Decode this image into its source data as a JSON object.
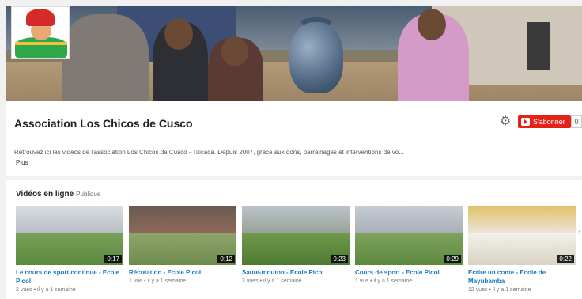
{
  "channel": {
    "title": "Association Los Chicos de Cusco",
    "description": "Retrouvez ici les vidéos de l'association Los Chicos de Cusco - Titicaca. Depuis 2007, grâce aux dons, parrainages et interventions de vo...",
    "more_label": "Plus",
    "subscribe_label": "S'abonner",
    "subscriber_count": "0"
  },
  "section": {
    "title": "Vidéos en ligne",
    "visibility": "Publique"
  },
  "videos": [
    {
      "title": "Le cours de sport continue - Ecole Picol",
      "duration": "0:17",
      "views": "2 vues",
      "age": "il y a 1 semaine"
    },
    {
      "title": "Récréation - Ecole Picol",
      "duration": "0:12",
      "views": "1 vue",
      "age": "il y a 1 semaine"
    },
    {
      "title": "Saute-mouton - Ecole Picol",
      "duration": "0:23",
      "views": "3 vues",
      "age": "il y a 1 semaine"
    },
    {
      "title": "Cours de sport - Ecole Picol",
      "duration": "0:29",
      "views": "1 vue",
      "age": "il y a 1 semaine"
    },
    {
      "title": "Ecrire un conte - Ecole de Mayubamba",
      "duration": "0:22",
      "views": "12 vues",
      "age": "il y a 1 semaine"
    }
  ],
  "colors": {
    "subscribe": "#e62117",
    "link": "#167ac6"
  }
}
